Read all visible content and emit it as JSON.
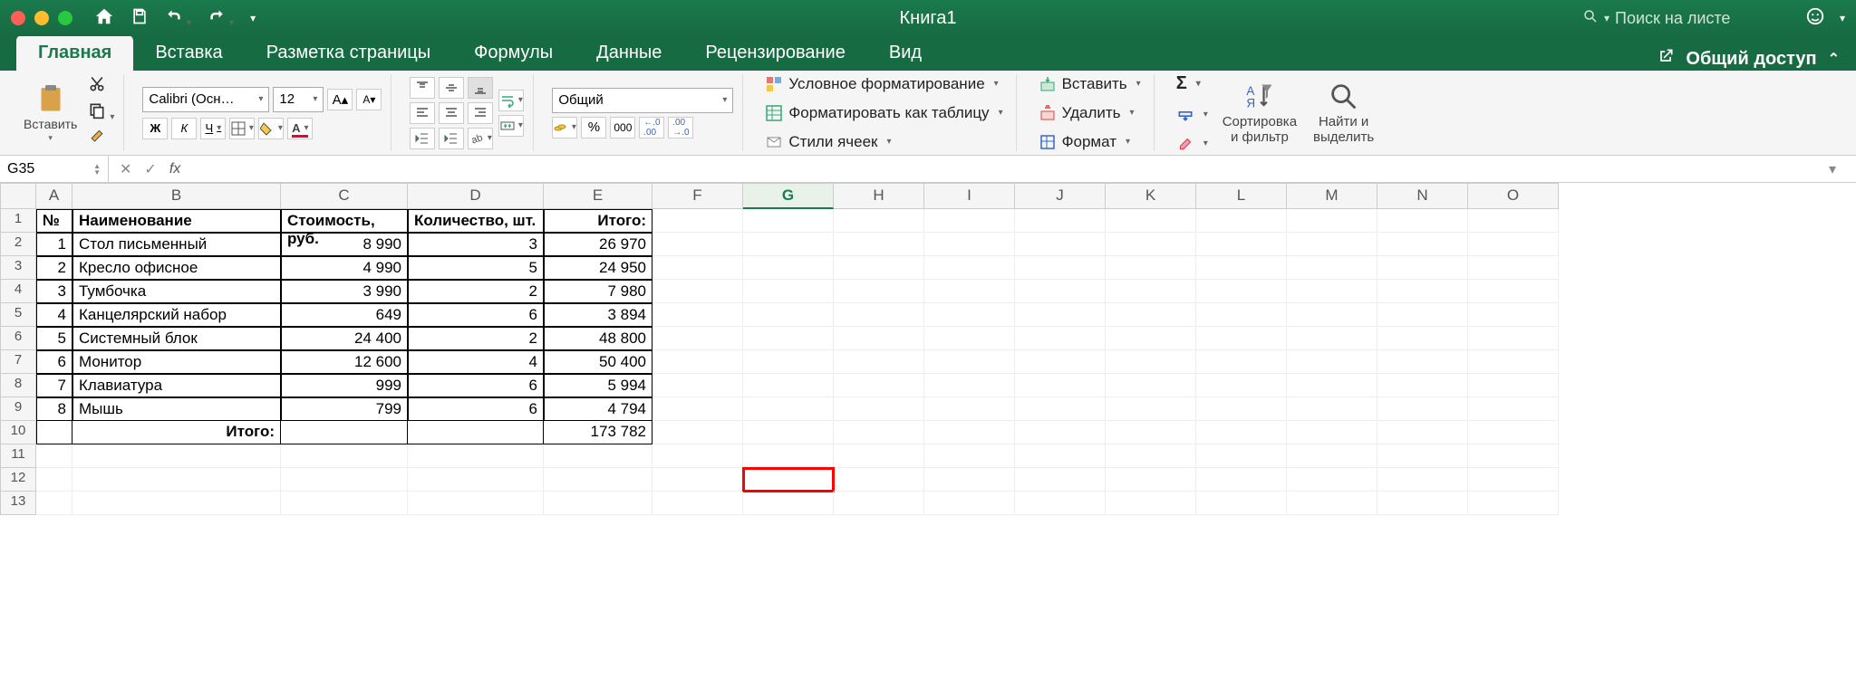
{
  "window": {
    "title": "Книга1"
  },
  "search": {
    "placeholder": "Поиск на листе"
  },
  "tabs": {
    "items": [
      "Главная",
      "Вставка",
      "Разметка страницы",
      "Формулы",
      "Данные",
      "Рецензирование",
      "Вид"
    ],
    "active": 0,
    "share": "Общий доступ"
  },
  "ribbon": {
    "paste": "Вставить",
    "font_name": "Calibri (Осн…",
    "font_size": "12",
    "number_format": "Общий",
    "cond_format": "Условное форматирование",
    "format_table": "Форматировать как таблицу",
    "cell_styles": "Стили ячеек",
    "insert": "Вставить",
    "delete": "Удалить",
    "format": "Формат",
    "sort_filter": "Сортировка\nи фильтр",
    "find_select": "Найти и\nвыделить"
  },
  "namebox": "G35",
  "active_cell": "G12",
  "columns": [
    "A",
    "B",
    "C",
    "D",
    "E",
    "F",
    "G",
    "H",
    "I",
    "J",
    "K",
    "L",
    "M",
    "N",
    "O"
  ],
  "headers": {
    "no": "№",
    "name": "Наименование",
    "cost": "Стоимость, руб.",
    "qty": "Количество, шт.",
    "total": "Итого:"
  },
  "rows": [
    {
      "n": "1",
      "name": "Стол письменный",
      "cost": "8 990",
      "qty": "3",
      "total": "26 970"
    },
    {
      "n": "2",
      "name": "Кресло офисное",
      "cost": "4 990",
      "qty": "5",
      "total": "24 950"
    },
    {
      "n": "3",
      "name": "Тумбочка",
      "cost": "3 990",
      "qty": "2",
      "total": "7 980"
    },
    {
      "n": "4",
      "name": "Канцелярский набор",
      "cost": "649",
      "qty": "6",
      "total": "3 894"
    },
    {
      "n": "5",
      "name": "Системный блок",
      "cost": "24 400",
      "qty": "2",
      "total": "48 800"
    },
    {
      "n": "6",
      "name": "Монитор",
      "cost": "12 600",
      "qty": "4",
      "total": "50 400"
    },
    {
      "n": "7",
      "name": "Клавиатура",
      "cost": "999",
      "qty": "6",
      "total": "5 994"
    },
    {
      "n": "8",
      "name": "Мышь",
      "cost": "799",
      "qty": "6",
      "total": "4 794"
    }
  ],
  "footer": {
    "label": "Итого:",
    "total": "173 782"
  }
}
